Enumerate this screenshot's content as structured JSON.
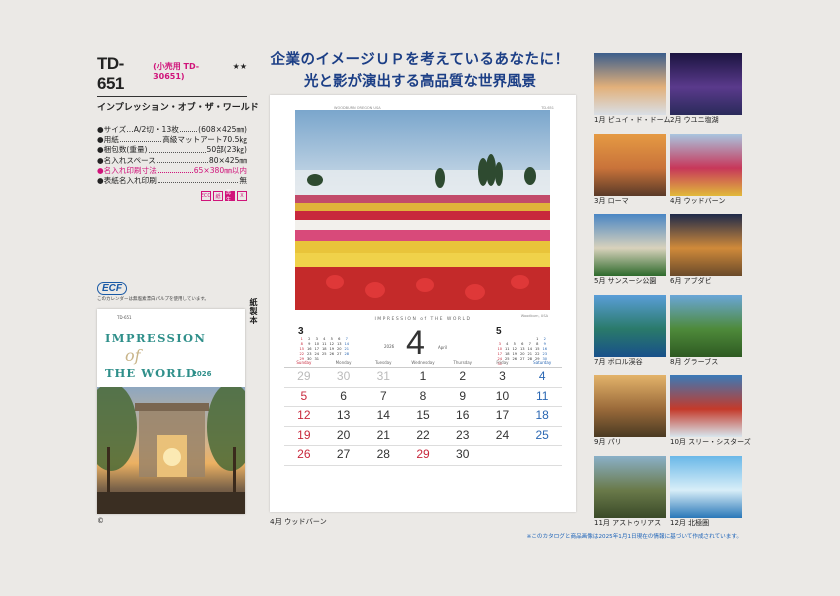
{
  "product": {
    "code": "TD-651",
    "retail_code": "(小売用 TD-30651)",
    "rating": "★★",
    "name": "インプレッション・オブ・ザ・ワールド"
  },
  "specs": [
    {
      "label": "●サイズ…A/2切・13枚",
      "value": "(608×425㎜)",
      "highlight": false
    },
    {
      "label": "●用紙",
      "value": "高級マットアート70.5㎏",
      "highlight": false
    },
    {
      "label": "●梱包数(重量)",
      "value": "50部(23㎏)",
      "highlight": false
    },
    {
      "label": "●名入れスペース",
      "value": "80×425㎜",
      "highlight": false
    },
    {
      "label": "●名入れ印刷寸法",
      "value": "65×380㎜以内",
      "highlight": true
    },
    {
      "label": "●表紙名入れ印刷",
      "value": "無",
      "highlight": false
    }
  ],
  "badges": [
    "ECO",
    "紙",
    "再生",
    "X"
  ],
  "ecf": {
    "logo": "ECF",
    "note": "このカレンダーは無塩素漂白パルプを使用しています。"
  },
  "vertical_label": "紙製本",
  "cover": {
    "code_text": "TD-651",
    "title_line1": "IMPRESSION",
    "title_of": "of",
    "title_line2": "THE WORLD",
    "year": "2026"
  },
  "copyright": "©",
  "headline": {
    "line1": "企業のイメージＵＰを考えているあなたに！",
    "line2": "光と影が演出する高品質な世界風景"
  },
  "calendar": {
    "page_note": "WOODBURN OREGON USA",
    "page_code": "TD-651",
    "brand": "IMPRESSION of THE WORLD",
    "photo_caption": "Woodburn, USA",
    "year": "2026",
    "month": "4",
    "month_en": "April",
    "day_headers": [
      "Sunday",
      "Monday",
      "Tuesday",
      "Wednesday",
      "Thursday",
      "Friday",
      "Saturday"
    ],
    "weeks": [
      [
        {
          "d": "29",
          "dim": true
        },
        {
          "d": "30",
          "dim": true
        },
        {
          "d": "31",
          "dim": true
        },
        {
          "d": "1"
        },
        {
          "d": "2"
        },
        {
          "d": "3"
        },
        {
          "d": "4"
        }
      ],
      [
        {
          "d": "5"
        },
        {
          "d": "6"
        },
        {
          "d": "7"
        },
        {
          "d": "8"
        },
        {
          "d": "9"
        },
        {
          "d": "10"
        },
        {
          "d": "11"
        }
      ],
      [
        {
          "d": "12"
        },
        {
          "d": "13"
        },
        {
          "d": "14"
        },
        {
          "d": "15"
        },
        {
          "d": "16"
        },
        {
          "d": "17"
        },
        {
          "d": "18"
        }
      ],
      [
        {
          "d": "19"
        },
        {
          "d": "20"
        },
        {
          "d": "21"
        },
        {
          "d": "22"
        },
        {
          "d": "23"
        },
        {
          "d": "24"
        },
        {
          "d": "25"
        }
      ],
      [
        {
          "d": "26"
        },
        {
          "d": "27"
        },
        {
          "d": "28"
        },
        {
          "d": "29",
          "holiday": true
        },
        {
          "d": "30"
        },
        {
          "d": ""
        },
        {
          "d": ""
        }
      ]
    ],
    "prev_month": {
      "label": "3",
      "rows": [
        [
          "1",
          "2",
          "3",
          "4",
          "5",
          "6",
          "7"
        ],
        [
          "8",
          "9",
          "10",
          "11",
          "12",
          "13",
          "14"
        ],
        [
          "15",
          "16",
          "17",
          "18",
          "19",
          "20",
          "21"
        ],
        [
          "22",
          "23",
          "24",
          "25",
          "26",
          "27",
          "28"
        ],
        [
          "29",
          "30",
          "31",
          "",
          "",
          "",
          ""
        ]
      ]
    },
    "next_month": {
      "label": "5",
      "rows": [
        [
          "",
          "",
          "",
          "",
          "",
          "1",
          "2"
        ],
        [
          "3",
          "4",
          "5",
          "6",
          "7",
          "8",
          "9"
        ],
        [
          "10",
          "11",
          "12",
          "13",
          "14",
          "15",
          "16"
        ],
        [
          "17",
          "18",
          "19",
          "20",
          "21",
          "22",
          "23"
        ],
        [
          "24",
          "25",
          "26",
          "27",
          "28",
          "29",
          "30"
        ],
        [
          "31",
          "",
          "",
          "",
          "",
          "",
          ""
        ]
      ]
    },
    "caption": "4月  ウッドバーン"
  },
  "thumbnails": [
    {
      "caption": "1月 ピュイ・ド・ドーム",
      "top": "#3b5e8c",
      "mid": "#e2b07a",
      "bottom": "#d9dfe6"
    },
    {
      "caption": "2月 ウユニ塩湖",
      "top": "#1b1440",
      "mid": "#5a3a8c",
      "bottom": "#2a2a5a"
    },
    {
      "caption": "3月 ローマ",
      "top": "#e59a43",
      "mid": "#c9733a",
      "bottom": "#5a3a28"
    },
    {
      "caption": "4月 ウッドバーン",
      "top": "#a9c5df",
      "mid": "#c7375a",
      "bottom": "#e1b93a"
    },
    {
      "caption": "5月 サンスーシ公園",
      "top": "#4a86c4",
      "mid": "#d8d2bc",
      "bottom": "#2e6a2c"
    },
    {
      "caption": "6月 アブダビ",
      "top": "#1e2a4a",
      "mid": "#d08a3a",
      "bottom": "#6a4a2a"
    },
    {
      "caption": "7月 ボロル渓谷",
      "top": "#5a9ed8",
      "mid": "#2a7a6a",
      "bottom": "#18508a"
    },
    {
      "caption": "8月 グラーブス",
      "top": "#6aa6d8",
      "mid": "#4e8a3a",
      "bottom": "#2e5a22"
    },
    {
      "caption": "9月 パリ",
      "top": "#e3b36a",
      "mid": "#9a6a3a",
      "bottom": "#4a3a22"
    },
    {
      "caption": "10月 スリー・シスターズ",
      "top": "#3a7ab8",
      "mid": "#c43a2a",
      "bottom": "#d8e6ee"
    },
    {
      "caption": "11月 アストゥリアス",
      "top": "#8ab0c8",
      "mid": "#6a7a4a",
      "bottom": "#3a4a28"
    },
    {
      "caption": "12月 北極圏",
      "top": "#6ab8e8",
      "mid": "#d8eef8",
      "bottom": "#2a78b8"
    }
  ],
  "footnote": "※このカタログと商品画像は2025年1月1日現在の情報に基づいて作成されています。"
}
